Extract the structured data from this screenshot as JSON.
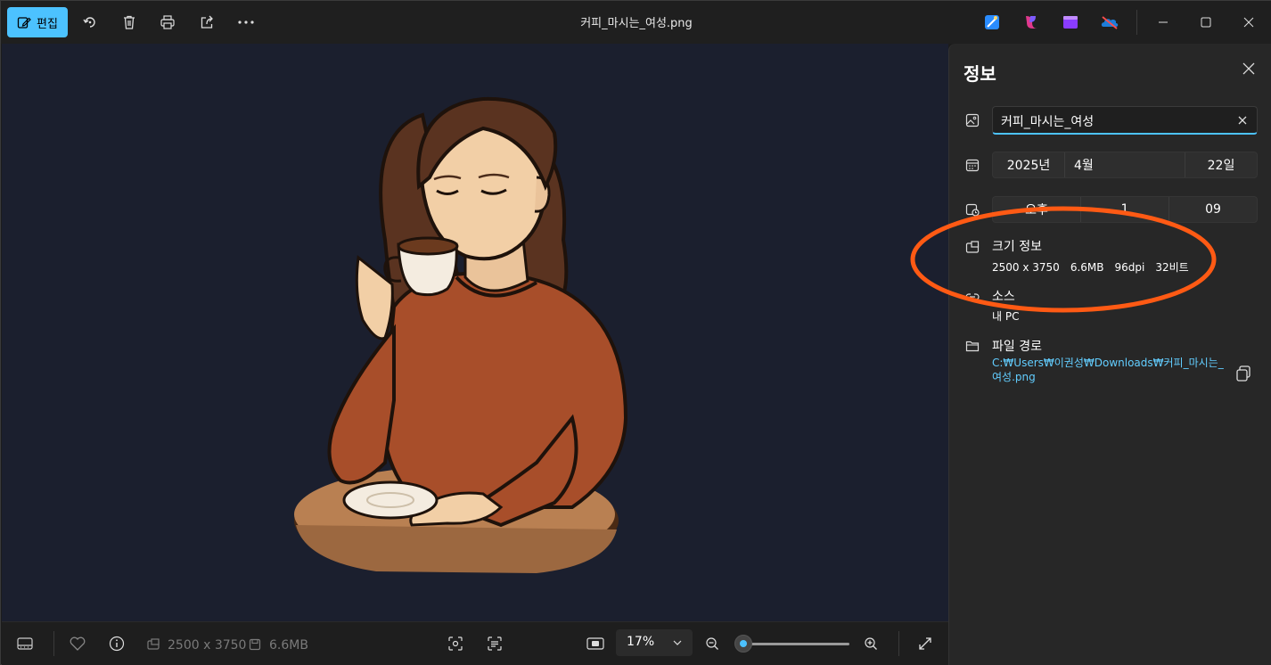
{
  "toolbar": {
    "edit_label": "편집",
    "title": "커피_마시는_여성.png"
  },
  "colors": {
    "accent": "#4cc2ff",
    "annotation": "#ff5a14",
    "link": "#62cdff"
  },
  "info_panel": {
    "title": "정보",
    "file_name": "커피_마시는_여성",
    "date": {
      "year": "2025년",
      "month": "4월",
      "day": "22일"
    },
    "time": {
      "ampm": "오후",
      "hour": "1",
      "minute": "09"
    },
    "size_info_label": "크기 정보",
    "size_details": {
      "dimensions": "2500 x 3750",
      "file_size": "6.6MB",
      "dpi": "96dpi",
      "bits": "32비트"
    },
    "source_label": "소스",
    "source_value": "내 PC",
    "path_label": "파일 경로",
    "path_value": "C:₩Users₩이권성₩Downloads₩커피_마시는_여성.png"
  },
  "bottom_bar": {
    "dimensions": "2500 x 3750",
    "file_size": "6.6MB",
    "zoom_value": "17%",
    "zoom_slider_fraction": 0.0
  },
  "icons": [
    "edit-icon",
    "rotate-icon",
    "delete-icon",
    "print-icon",
    "share-icon",
    "more-icon",
    "designer-icon",
    "copilot-icon",
    "clipchamp-icon",
    "onedrive-icon",
    "minimize-icon",
    "maximize-icon",
    "close-icon",
    "filmstrip-icon",
    "favorite-icon",
    "info-icon",
    "resolution-icon",
    "save-icon",
    "face-detect-icon",
    "ocr-icon",
    "actual-size-icon",
    "zoom-out-icon",
    "zoom-in-icon",
    "fullscreen-icon",
    "image-icon",
    "calendar-icon",
    "clock-icon",
    "size-icon",
    "source-icon",
    "folder-icon",
    "copy-icon"
  ]
}
